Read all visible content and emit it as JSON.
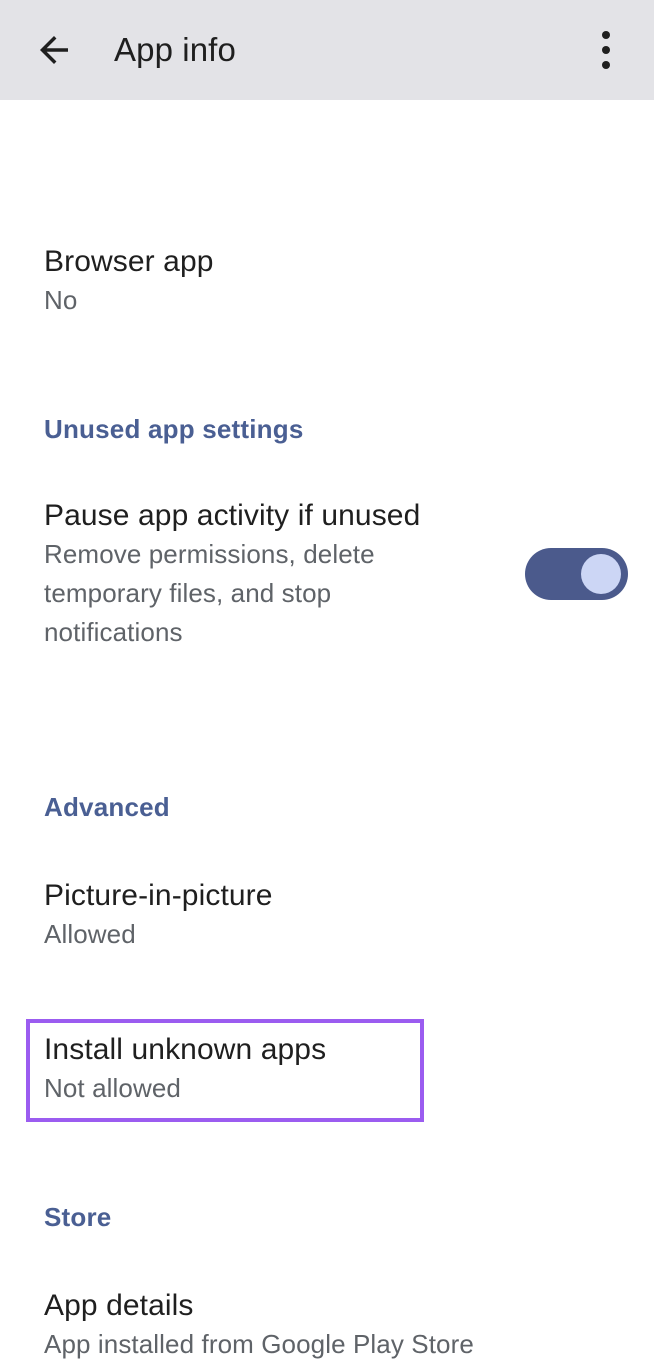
{
  "appbar": {
    "back_icon": "arrow-left-icon",
    "title": "App info",
    "overflow_icon": "more-vertical-icon"
  },
  "colors": {
    "appbar_background": "#e3e3e7",
    "section_header": "#4a5f93",
    "primary_text": "#1f1f1f",
    "secondary_text": "#5f6368",
    "switch_track_on": "#4b5a8c",
    "switch_thumb_on": "#ccd6f5",
    "highlight_border": "#9b5cf0",
    "page_background": "#ffffff"
  },
  "preferences": {
    "browser_app": {
      "title": "Browser app",
      "summary": "No"
    },
    "pause_app_activity": {
      "title": "Pause app activity if unused",
      "summary": "Remove permissions, delete temporary files, and stop notifications",
      "switch_state": "on"
    },
    "picture_in_picture": {
      "title": "Picture-in-picture",
      "summary": "Allowed"
    },
    "install_unknown_apps": {
      "title": "Install unknown apps",
      "summary": "Not allowed",
      "highlighted": true
    },
    "app_details": {
      "title": "App details",
      "summary": "App installed from Google Play Store"
    }
  },
  "sections": {
    "unused_app_settings": "Unused app settings",
    "advanced": "Advanced",
    "store": "Store"
  }
}
